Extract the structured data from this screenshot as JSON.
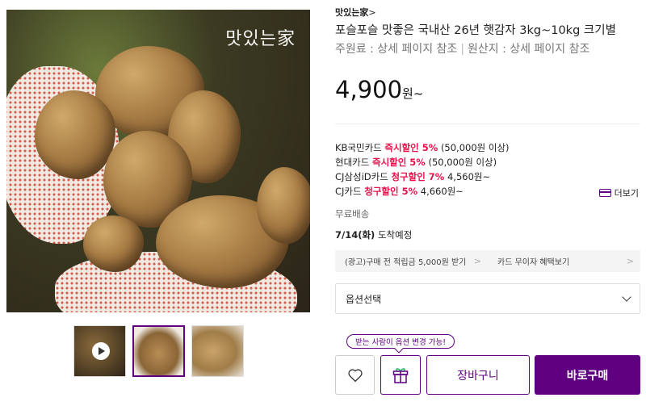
{
  "gallery": {
    "brand_mark": "맛있는家"
  },
  "product": {
    "brand": "맛있는家",
    "brand_chevron": ">",
    "title": "포슬포슬 맛좋은 국내산 26년 햇감자 3kg~10kg 크기별",
    "ingredient": "주원료 : 상세 페이지 참조",
    "separator": "|",
    "origin": "원산지 : 상세 페이지 참조",
    "price": "4,900",
    "price_unit": "원~"
  },
  "card_offers": [
    {
      "card": "KB국민카드",
      "discount": "즉시할인 5%",
      "detail": "(50,000원 이상)"
    },
    {
      "card": "현대카드",
      "discount": "즉시할인 5%",
      "detail": "(50,000원 이상)"
    },
    {
      "card": "CJ삼성iD카드",
      "discount": "청구할인 7%",
      "detail": "4,560원~"
    },
    {
      "card": "CJ카드",
      "discount": "청구할인 5%",
      "detail": "4,660원~"
    }
  ],
  "more_label": "더보기",
  "shipping": "무료배송",
  "arrival": {
    "date": "7/14(화)",
    "text": "도착예정"
  },
  "benefits": [
    {
      "label": "(광고)구매 전 적립금 5,000원 받기",
      "arrow": ">"
    },
    {
      "label": "카드 무이자 혜택보기",
      "arrow": ">"
    }
  ],
  "option_select": {
    "label": "옵션선택"
  },
  "tooltip": "받는 사람이 옵션 변경 가능!",
  "buttons": {
    "cart": "장바구니",
    "buy": "바로구매"
  },
  "colors": {
    "brand_purple": "#5f0080",
    "discount_red": "#e8114b"
  }
}
